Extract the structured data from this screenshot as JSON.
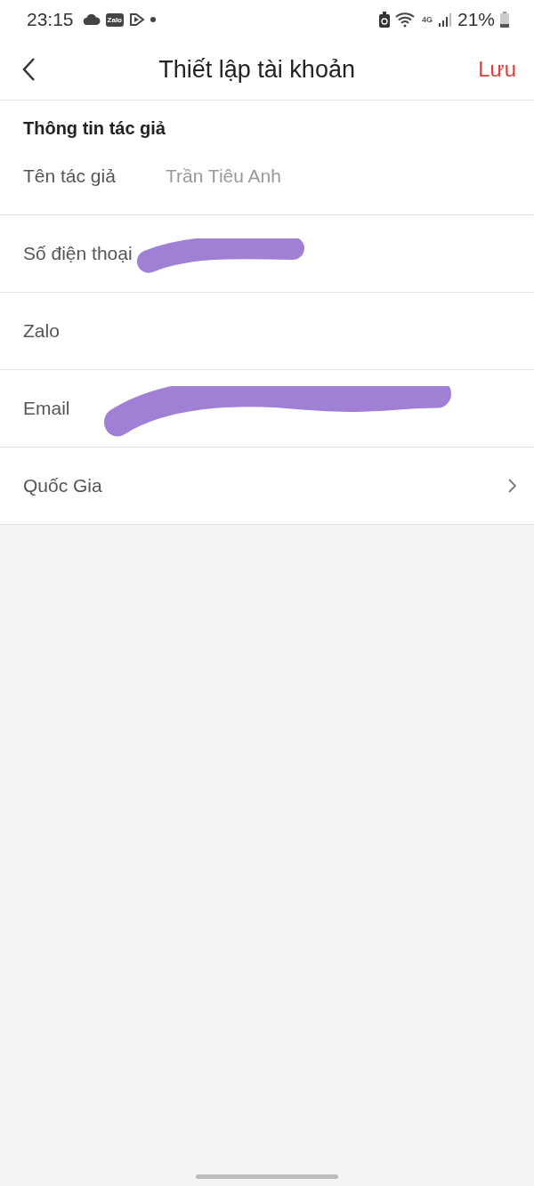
{
  "status_bar": {
    "time": "23:15",
    "notification_icons": [
      {
        "kind": "cloud"
      },
      {
        "kind": "app",
        "label": "Zalo"
      },
      {
        "kind": "play"
      },
      {
        "kind": "dot"
      }
    ],
    "network": "4G",
    "battery": "21%"
  },
  "header": {
    "title": "Thiết lập tài khoản",
    "action": "Lưu"
  },
  "section": {
    "title": "Thông tin tác giả"
  },
  "fields": [
    {
      "kind": "text",
      "label": "Tên tác giả",
      "placeholder": "Trần Tiêu Anh",
      "redacted": false
    },
    {
      "kind": "text",
      "label": "Số điện thoại",
      "redacted": true
    },
    {
      "kind": "text",
      "label": "Zalo",
      "redacted": false
    },
    {
      "kind": "text",
      "label": "Email",
      "redacted": true
    },
    {
      "kind": "select",
      "label": "Quốc Gia"
    }
  ]
}
